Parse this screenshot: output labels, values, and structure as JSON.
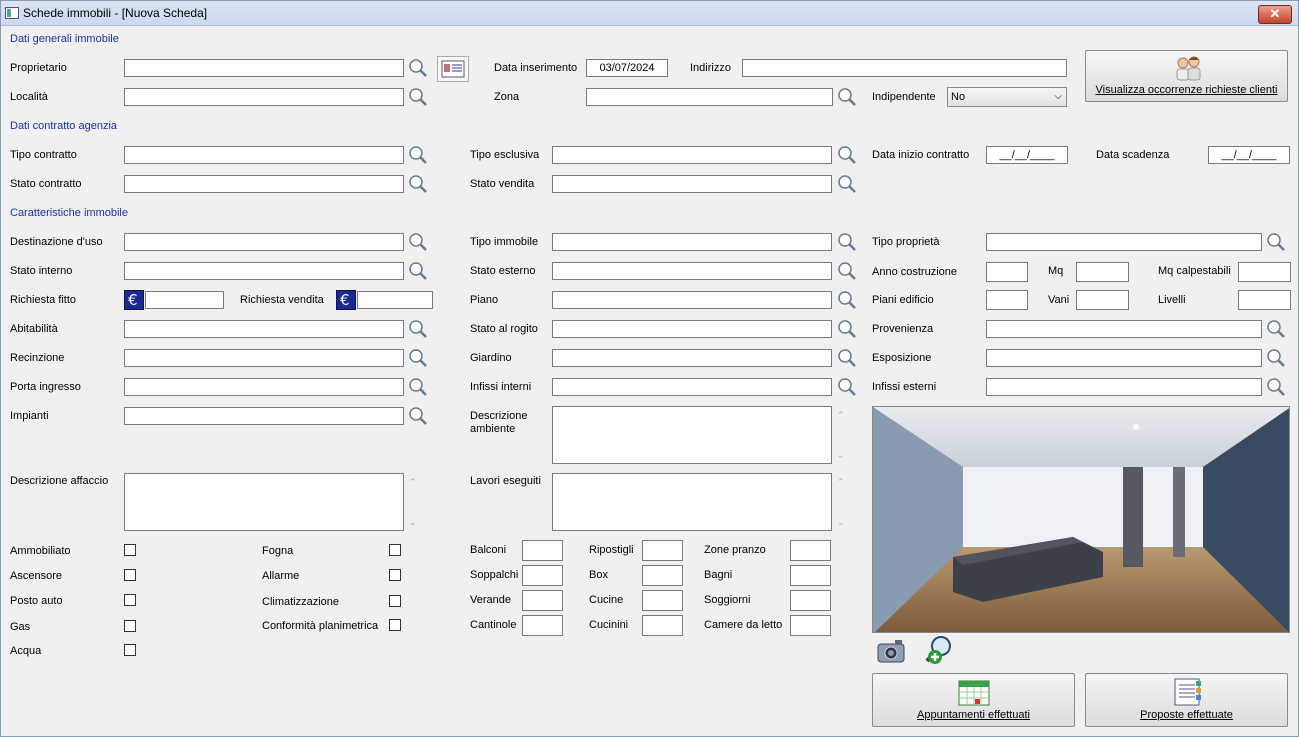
{
  "window": {
    "title": "Schede immobili - [Nuova Scheda]",
    "close_label": "✕"
  },
  "sections": {
    "general": "Dati generali immobile",
    "contract": "Dati contratto agenzia",
    "features": "Caratteristiche immobile"
  },
  "labels": {
    "proprietario": "Proprietario",
    "localita": "Località",
    "data_inserimento": "Data inserimento",
    "indirizzo": "Indirizzo",
    "zona": "Zona",
    "indipendente": "Indipendente",
    "tipo_contratto": "Tipo contratto",
    "stato_contratto": "Stato contratto",
    "tipo_esclusiva": "Tipo esclusiva",
    "stato_vendita": "Stato vendita",
    "data_inizio_contratto": "Data inizio contratto",
    "data_scadenza": "Data scadenza",
    "destinazione_uso": "Destinazione d'uso",
    "stato_interno": "Stato interno",
    "richiesta_fitto": "Richiesta fitto",
    "richiesta_vendita": "Richiesta vendita",
    "abitabilita": "Abitabilità",
    "recinzione": "Recinzione",
    "porta_ingresso": "Porta ingresso",
    "impianti": "Impianti",
    "descrizione_affaccio": "Descrizione affaccio",
    "tipo_immobile": "Tipo immobile",
    "stato_esterno": "Stato esterno",
    "piano": "Piano",
    "stato_rogito": "Stato al rogito",
    "giardino": "Giardino",
    "infissi_interni": "Infissi interni",
    "descrizione_ambiente": "Descrizione\nambiente",
    "lavori_eseguiti": "Lavori eseguiti",
    "tipo_proprieta": "Tipo proprietà",
    "anno_costruzione": "Anno costruzione",
    "mq": "Mq",
    "mq_calpestabili": "Mq calpestabili",
    "piani_edificio": "Piani edificio",
    "vani": "Vani",
    "livelli": "Livelli",
    "provenienza": "Provenienza",
    "esposizione": "Esposizione",
    "infissi_esterni": "Infissi esterni",
    "ammobiliato": "Ammobiliato",
    "ascensore": "Ascensore",
    "posto_auto": "Posto auto",
    "gas": "Gas",
    "acqua": "Acqua",
    "fogna": "Fogna",
    "allarme": "Allarme",
    "climatizzazione": "Climatizzazione",
    "conformita": "Conformità planimetrica",
    "balconi": "Balconi",
    "soppalchi": "Soppalchi",
    "verande": "Verande",
    "cantinole": "Cantinole",
    "ripostigli": "Ripostigli",
    "box": "Box",
    "cucine": "Cucine",
    "cucinini": "Cucinini",
    "zone_pranzo": "Zone pranzo",
    "bagni": "Bagni",
    "soggiorni": "Soggiorni",
    "camere_letto": "Camere da letto"
  },
  "values": {
    "data_inserimento": "03/07/2024",
    "indipendente": "No",
    "data_inizio_contratto": "__/__/____",
    "data_scadenza": "__/__/____"
  },
  "buttons": {
    "occorrenze": "Visualizza occorrenze richieste clienti",
    "appuntamenti": "Appuntamenti effettuati",
    "proposte": "Proposte effettuate"
  },
  "colors": {
    "section": "#1a2fa8",
    "euro_badge": "#1b2a8f"
  }
}
